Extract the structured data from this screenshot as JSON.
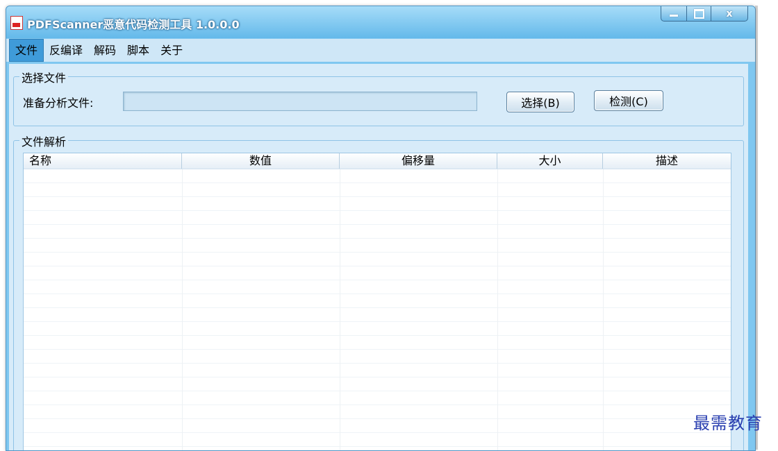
{
  "window": {
    "title": "PDFScanner恶意代码检测工具 1.0.0.0",
    "controls": {
      "minimize": "—",
      "maximize": "□",
      "close": "x"
    }
  },
  "menu": [
    "文件",
    "反编译",
    "解码",
    "脚本",
    "关于"
  ],
  "select_group": {
    "title": "选择文件",
    "file_label": "准备分析文件:",
    "file_value": "",
    "select_button": "选择(B)",
    "detect_button": "检测(C)"
  },
  "parse_group": {
    "title": "文件解析",
    "columns": [
      "名称",
      "数值",
      "偏移量",
      "大小",
      "描述"
    ],
    "rows": []
  },
  "watermark": "最需教育",
  "colors": {
    "titlebar": "#64b9ea",
    "menu_active": "#3f9bd9",
    "client": "#d7ebf9"
  }
}
